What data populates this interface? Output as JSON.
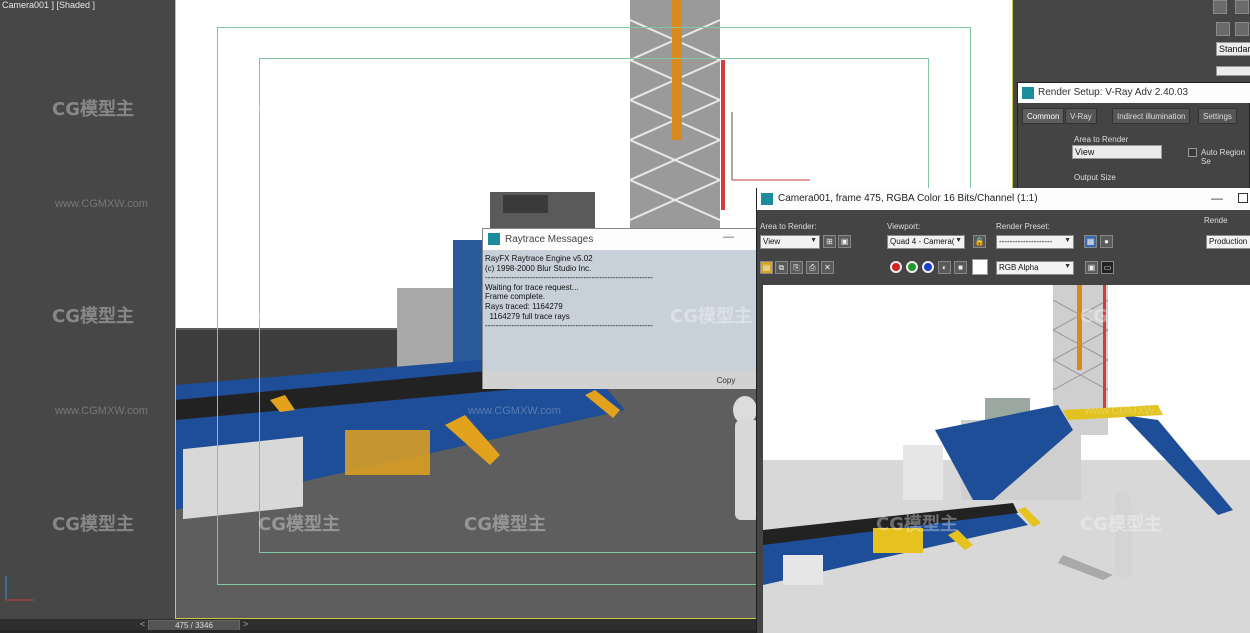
{
  "viewport_left": {
    "label": "Camera001 ] [Shaded ]"
  },
  "raytrace": {
    "title": "Raytrace Messages",
    "lines": [
      "RayFX Raytrace Engine v5.02",
      "(c) 1998-2000 Blur Studio Inc.",
      "---------------------------------------------------------------",
      "",
      "Waiting for trace request...",
      "",
      "Frame complete.",
      "Rays traced: 1164279",
      "  1164279 full trace rays",
      "---------------------------------------------------------------"
    ],
    "copy_label": "Copy",
    "minimize_glyph": "—"
  },
  "render_setup": {
    "title": "Render Setup: V-Ray Adv 2.40.03",
    "tabs": [
      "Common",
      "V-Ray",
      "Indirect illumination",
      "Settings"
    ],
    "area_label": "Area to Render",
    "area_value": "View",
    "auto_region": "Auto Region Se",
    "output_size": "Output Size"
  },
  "right_panel": {
    "standard": "Standard"
  },
  "framebuffer": {
    "title": "Camera001, frame 475, RGBA Color 16 Bits/Channel (1:1)",
    "area_label": "Area to Render:",
    "area_value": "View",
    "viewport_label": "Viewport:",
    "viewport_value": "Quad 4 - Camera(",
    "preset_label": "Render Preset:",
    "preset_value": "--------------------",
    "render_label": "Rende",
    "render_value": "Production",
    "channel_value": "RGB Alpha",
    "minimize_glyph": "—",
    "colors": {
      "red": "#d42020",
      "green": "#1f9a2a",
      "blue": "#1c3fcc"
    }
  },
  "statusbar": {
    "frame": "475 / 3346",
    "prev": "<",
    "next": ">"
  },
  "watermark": {
    "logo": "CG模型主",
    "url": "www.CGMXW.com"
  }
}
